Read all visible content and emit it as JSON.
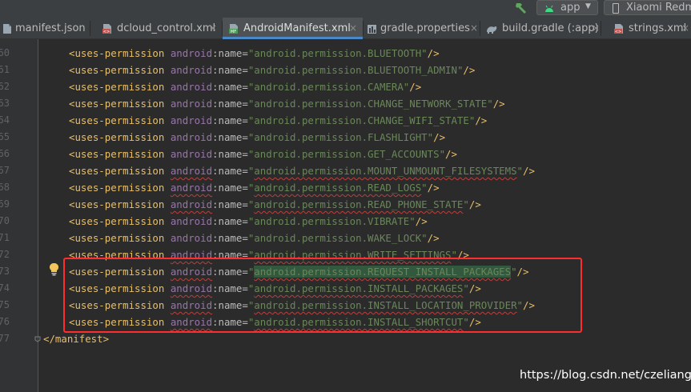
{
  "toolbar": {
    "run_config": "app",
    "device": "Xiaomi Redmi"
  },
  "tabs": [
    {
      "label": "manifest.json",
      "icon": "json-file-icon",
      "active": false
    },
    {
      "label": "dcloud_control.xml",
      "icon": "xml-file-icon",
      "active": false
    },
    {
      "label": "AndroidManifest.xml",
      "icon": "manifest-file-icon",
      "active": true
    },
    {
      "label": "gradle.properties",
      "icon": "properties-file-icon",
      "active": false
    },
    {
      "label": "build.gradle (:app)",
      "icon": "gradle-file-icon",
      "active": false
    },
    {
      "label": "strings.xml",
      "icon": "xml-file-icon",
      "active": false
    }
  ],
  "editor": {
    "line_numbers": [
      "60",
      "61",
      "62",
      "63",
      "64",
      "65",
      "66",
      "67",
      "68",
      "69",
      "70",
      "71",
      "72",
      "73",
      "74",
      "75",
      "76",
      "77"
    ],
    "tag": "uses-permission",
    "ns": "android",
    "attr": "name",
    "permissions": [
      "android.permission.BLUETOOTH",
      "android.permission.BLUETOOTH_ADMIN",
      "android.permission.CAMERA",
      "android.permission.CHANGE_NETWORK_STATE",
      "android.permission.CHANGE_WIFI_STATE",
      "android.permission.FLASHLIGHT",
      "android.permission.GET_ACCOUNTS",
      "android.permission.MOUNT_UNMOUNT_FILESYSTEMS",
      "android.permission.READ_LOGS",
      "android.permission.READ_PHONE_STATE",
      "android.permission.VIBRATE",
      "android.permission.WAKE_LOCK",
      "android.permission.WRITE_SETTINGS",
      "android.permission.REQUEST_INSTALL_PACKAGES",
      "android.permission.INSTALL_PACKAGES",
      "android.permission.INSTALL_LOCATION_PROVIDER",
      "android.permission.INSTALL_SHORTCUT"
    ],
    "closing_tag": "</manifest>"
  },
  "colors": {
    "tag": "#e8bf6a",
    "namespace": "#9876aa",
    "attribute": "#bababa",
    "string": "#6a8759",
    "highlight_box": "#ff2d2d",
    "active_tab_underline": "#4a88c7"
  },
  "watermark": "https://blog.csdn.net/czeliang"
}
